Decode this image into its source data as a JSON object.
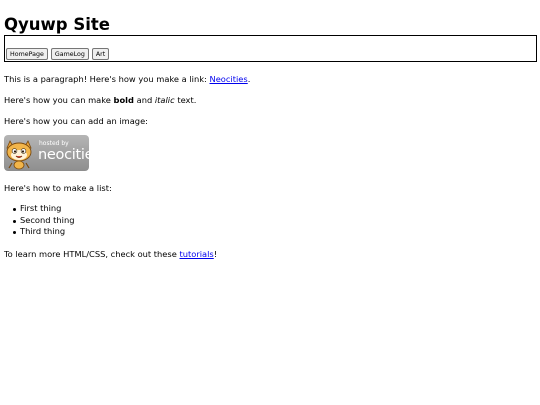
{
  "site": {
    "title": "Qyuwp Site"
  },
  "nav": {
    "buttons": [
      "HomePage",
      "GameLog",
      "Art"
    ]
  },
  "content": {
    "p1_text": "This is a paragraph! Here's how you make a link: ",
    "p1_link": "Neocities",
    "p1_end": ".",
    "p2_start": "Here's how you can make ",
    "p2_bold": "bold",
    "p2_mid": " and ",
    "p2_italic": "italic",
    "p2_end": " text.",
    "p3_text": "Here's how you can add an image:",
    "badge": {
      "small": "hosted by",
      "large": "neocities"
    },
    "p4_text": "Here's how to make a list:",
    "list": [
      "First thing",
      "Second thing",
      "Third thing"
    ],
    "p5_text": "To learn more HTML/CSS, check out these ",
    "p5_link": "tutorials",
    "p5_end": "!"
  }
}
